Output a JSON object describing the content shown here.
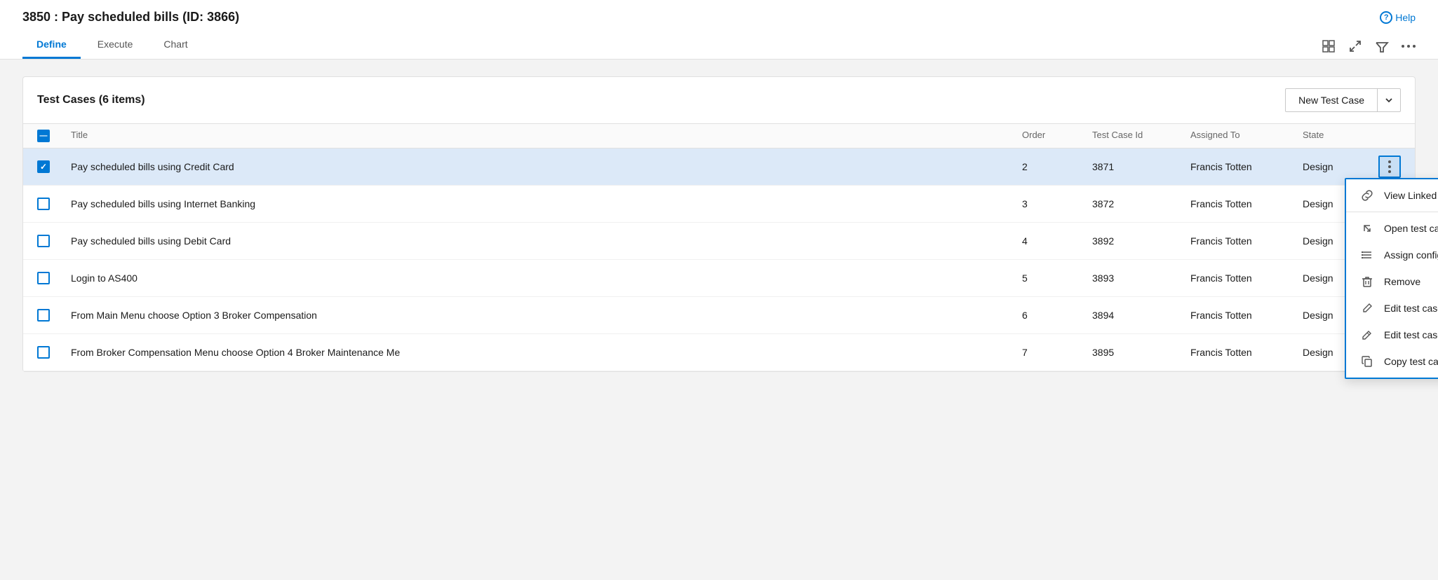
{
  "header": {
    "title": "3850 : Pay scheduled bills (ID: 3866)",
    "help_label": "Help"
  },
  "tabs": [
    {
      "id": "define",
      "label": "Define",
      "active": true
    },
    {
      "id": "execute",
      "label": "Execute",
      "active": false
    },
    {
      "id": "chart",
      "label": "Chart",
      "active": false
    }
  ],
  "toolbar": {
    "grid_icon": "⊞",
    "expand_icon": "↗",
    "filter_icon": "⋁",
    "more_icon": "⋮"
  },
  "panel": {
    "title": "Test Cases (6 items)",
    "new_test_case_label": "New Test Case",
    "columns": {
      "title": "Title",
      "order": "Order",
      "test_case_id": "Test Case Id",
      "assigned_to": "Assigned To",
      "state": "State"
    },
    "rows": [
      {
        "id": 1,
        "checked": true,
        "title": "Pay scheduled bills using Credit Card",
        "order": "2",
        "test_case_id": "3871",
        "assigned_to": "Francis Totten",
        "state": "Design",
        "active": true
      },
      {
        "id": 2,
        "checked": false,
        "title": "Pay scheduled bills using Internet Banking",
        "order": "3",
        "test_case_id": "3872",
        "assigned_to": "Francis Totten",
        "state": "Design",
        "active": false
      },
      {
        "id": 3,
        "checked": false,
        "title": "Pay scheduled bills using Debit Card",
        "order": "4",
        "test_case_id": "3892",
        "assigned_to": "Francis Totten",
        "state": "Design",
        "active": false
      },
      {
        "id": 4,
        "checked": false,
        "title": "Login to AS400",
        "order": "5",
        "test_case_id": "3893",
        "assigned_to": "Francis Totten",
        "state": "Design",
        "active": false
      },
      {
        "id": 5,
        "checked": false,
        "title": "From Main Menu choose Option 3 Broker Compensation",
        "order": "6",
        "test_case_id": "3894",
        "assigned_to": "Francis Totten",
        "state": "Design",
        "active": false
      },
      {
        "id": 6,
        "checked": false,
        "title": "From Broker Compensation Menu choose Option 4 Broker Maintenance Me",
        "order": "7",
        "test_case_id": "3895",
        "assigned_to": "Francis Totten",
        "state": "Design",
        "active": false
      }
    ],
    "context_menu": {
      "items": [
        {
          "id": "view-linked",
          "label": "View Linked Items",
          "icon": "link"
        },
        {
          "id": "open-test-case",
          "label": "Open test case",
          "icon": "open"
        },
        {
          "id": "assign-config",
          "label": "Assign configuration",
          "icon": "list"
        },
        {
          "id": "remove",
          "label": "Remove",
          "icon": "trash"
        },
        {
          "id": "edit-grid",
          "label": "Edit test case(s) in grid",
          "icon": "pencil"
        },
        {
          "id": "edit",
          "label": "Edit test case(s)",
          "icon": "pencil2"
        },
        {
          "id": "copy",
          "label": "Copy test case(s)",
          "icon": "copy"
        }
      ]
    }
  }
}
